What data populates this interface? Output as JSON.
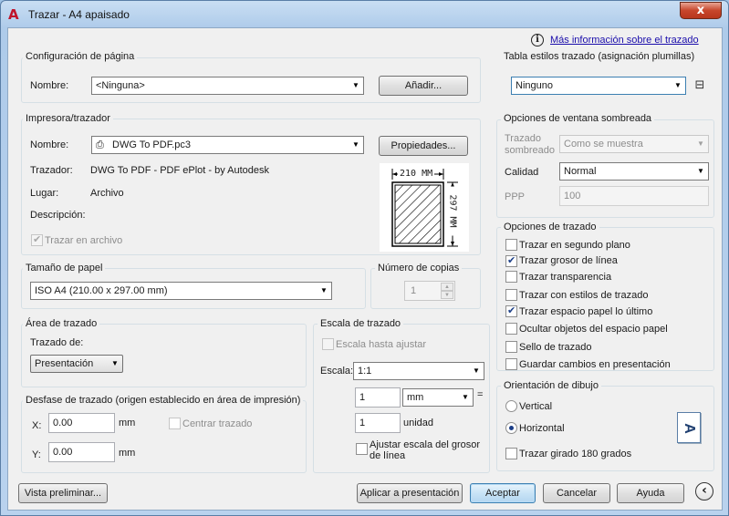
{
  "window": {
    "title": "Trazar - A4 apaisado",
    "close_symbol": "x"
  },
  "info_link": "Más información sobre el trazado",
  "page_setup": {
    "group_title": "Configuración de página",
    "name_label": "Nombre:",
    "name_value": "<Ninguna>",
    "add_button": "Añadir..."
  },
  "printer": {
    "group_title": "Impresora/trazador",
    "name_label": "Nombre:",
    "name_value": "DWG To PDF.pc3",
    "properties_button": "Propiedades...",
    "plotter_label": "Trazador:",
    "plotter_value": "DWG To PDF - PDF ePlot - by Autodesk",
    "location_label": "Lugar:",
    "location_value": "Archivo",
    "description_label": "Descripción:",
    "plot_to_file_label": "Trazar en archivo",
    "plot_to_file_checked": true,
    "preview_width": "210 MM",
    "preview_height": "297 MM"
  },
  "paper_size": {
    "group_title": "Tamaño de papel",
    "value": "ISO A4 (210.00 x 297.00 mm)"
  },
  "copies": {
    "group_title": "Número de copias",
    "value": "1"
  },
  "plot_area": {
    "group_title": "Área de trazado",
    "what_label": "Trazado de:",
    "what_value": "Presentación"
  },
  "plot_offset": {
    "group_title": "Desfase de trazado (origen establecido en área de impresión)",
    "x_label": "X:",
    "x_value": "0.00",
    "x_unit": "mm",
    "y_label": "Y:",
    "y_value": "0.00",
    "y_unit": "mm",
    "center_label": "Centrar trazado",
    "center_checked": false
  },
  "plot_scale": {
    "group_title": "Escala de trazado",
    "fit_label": "Escala hasta ajustar",
    "fit_checked": false,
    "scale_label": "Escala:",
    "scale_value": "1:1",
    "value1": "1",
    "unit1": "mm",
    "equals": "=",
    "value2": "1",
    "unit2": "unidad",
    "lineweights_label_1": "Ajustar escala del grosor",
    "lineweights_label_2": "de línea",
    "lineweights_checked": false
  },
  "plot_style_table": {
    "group_title": "Tabla estilos trazado (asignación plumillas)",
    "value": "Ninguno"
  },
  "shaded_viewport": {
    "group_title": "Opciones de ventana sombreada",
    "shade_label_1": "Trazado",
    "shade_label_2": "sombreado",
    "shade_value": "Como se muestra",
    "quality_label": "Calidad",
    "quality_value": "Normal",
    "dpi_label": "PPP",
    "dpi_value": "100"
  },
  "plot_options": {
    "group_title": "Opciones de trazado",
    "items": [
      {
        "label": "Trazar en segundo plano",
        "checked": false
      },
      {
        "label": "Trazar grosor de línea",
        "checked": true
      },
      {
        "label": "Trazar transparencia",
        "checked": false
      },
      {
        "label": "Trazar con estilos de trazado",
        "checked": false
      },
      {
        "label": "Trazar espacio papel lo último",
        "checked": true
      },
      {
        "label": "Ocultar objetos del espacio papel",
        "checked": false
      },
      {
        "label": "Sello de trazado",
        "checked": false
      },
      {
        "label": "Guardar cambios en presentación",
        "checked": false
      }
    ]
  },
  "orientation": {
    "group_title": "Orientación de dibujo",
    "vertical_label": "Vertical",
    "horizontal_label": "Horizontal",
    "selected": "Horizontal",
    "upside_down_label": "Trazar girado 180 grados",
    "upside_down_checked": false,
    "icon_letter": "A"
  },
  "buttons": {
    "preview": "Vista preliminar...",
    "apply": "Aplicar a presentación",
    "ok": "Aceptar",
    "cancel": "Cancelar",
    "help": "Ayuda",
    "collapse_symbol": "‹"
  }
}
